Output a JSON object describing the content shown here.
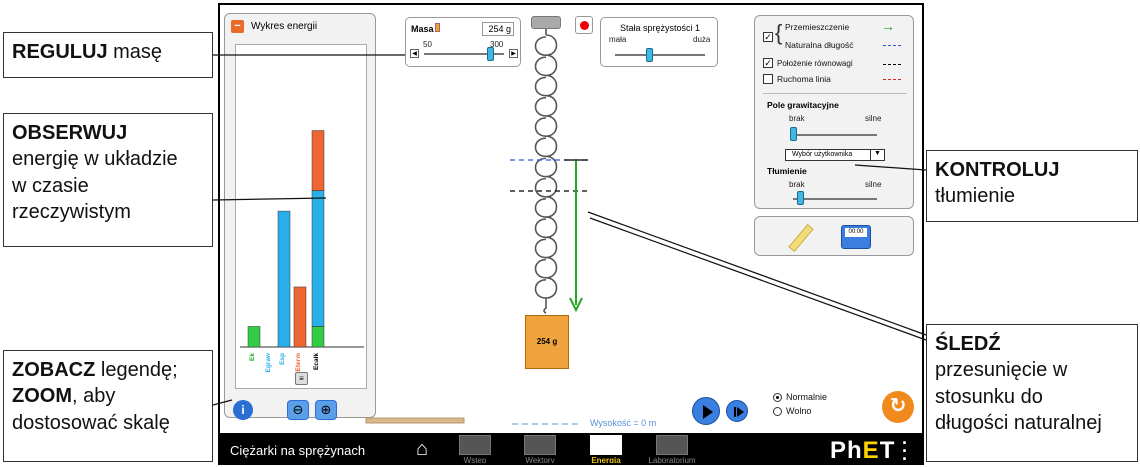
{
  "callouts": {
    "mass": {
      "bold": "REGULUJ",
      "rest": " masę"
    },
    "observe": {
      "bold": "OBSERWUJ",
      "l1": "energię w układzie",
      "l2": "w czasie",
      "l3": "rzeczywistym"
    },
    "legend": {
      "bold1": "ZOBACZ",
      "rest1": " legendę;",
      "bold2": "ZOOM",
      "rest2": ", aby",
      "l3": "dostosować skalę"
    },
    "damping": {
      "bold": "KONTROLUJ",
      "l2": "tłumienie"
    },
    "track": {
      "bold": "ŚLEDŹ",
      "l2": "przesunięcie w",
      "l3": "stosunku do",
      "l4": "długości naturalnej"
    }
  },
  "energy_panel": {
    "title": "Wykres energii",
    "legend_labels": [
      "Ek",
      "Egraw",
      "Esp",
      "Eterm",
      "Ecałk"
    ]
  },
  "energy_chart": {
    "bars": [
      {
        "name": "Ek",
        "value": 0.13,
        "color": "#33cc44"
      },
      {
        "name": "Egraw",
        "value": 0,
        "color": "#2ab0e8"
      },
      {
        "name": "Esp",
        "value": 0.86,
        "color": "#2ab0e8"
      },
      {
        "name": "Eterm",
        "value": 0.38,
        "color": "#ee6633"
      },
      {
        "name": "Ecałk",
        "segments": [
          {
            "value": 0.13,
            "color": "#33cc44"
          },
          {
            "value": 0.86,
            "color": "#2ab0e8"
          },
          {
            "value": 0.38,
            "color": "#ee6633"
          }
        ]
      }
    ]
  },
  "mass_control": {
    "label": "Masa",
    "value": "254 g",
    "min": "50",
    "max": "300",
    "fraction": 0.82
  },
  "spring_constant": {
    "label": "Stała sprężystości 1",
    "min": "mała",
    "max": "duża",
    "fraction": 0.38
  },
  "options": {
    "displacement": "Przemieszczenie",
    "natural_length": "Naturalna długość",
    "equilibrium": "Położenie równowagi",
    "movable_line": "Ruchoma linia",
    "colors": {
      "displacement": "#22aa22",
      "natural": "#3355dd",
      "equilibrium": "#000000",
      "movable": "#dd2222"
    }
  },
  "gravity": {
    "title": "Pole grawitacyjne",
    "min": "brak",
    "max": "silne",
    "select": "Wybór użytkownika",
    "fraction": 0.0
  },
  "damping": {
    "title": "Tłumienie",
    "min": "brak",
    "max": "silne",
    "fraction": 0.08
  },
  "mass_block_label": "254 g",
  "height_label": "Wysokość = 0 m",
  "speed": {
    "normal": "Normalnie",
    "slow": "Wolno"
  },
  "stopwatch": "00:00",
  "navbar": {
    "title": "Ciężarki na sprężynach",
    "tabs": [
      "Wstęp",
      "Wektory",
      "Energia",
      "Laboratorium"
    ],
    "active": 2,
    "logo_ph": "Ph",
    "logo_e": "E",
    "logo_t": "T"
  }
}
